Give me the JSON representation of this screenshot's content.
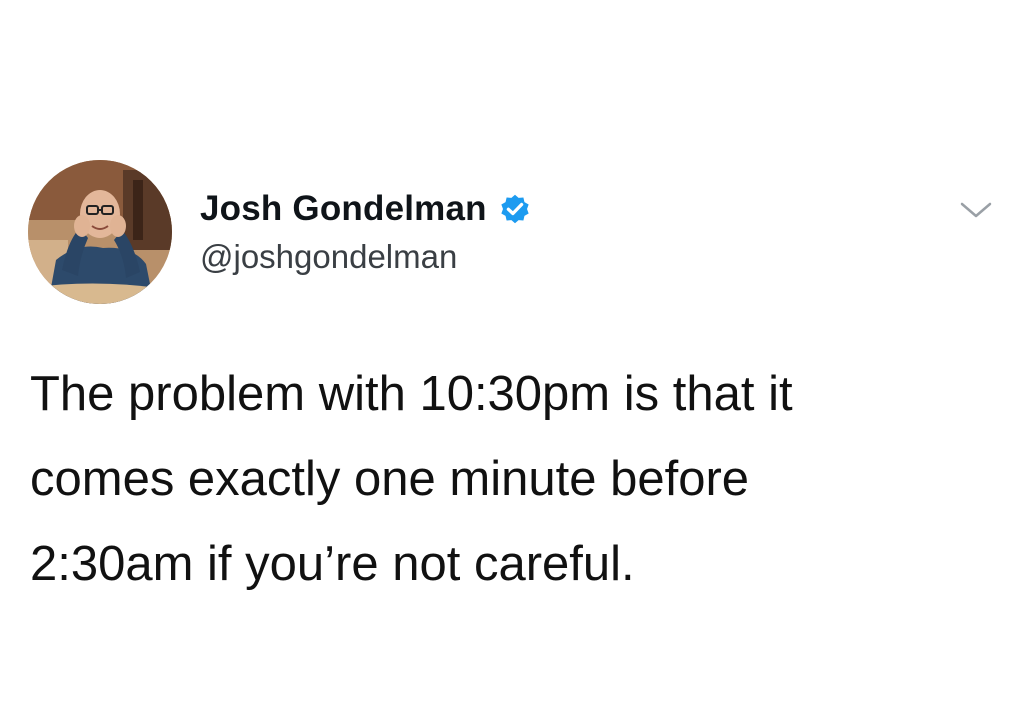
{
  "tweet": {
    "author": {
      "display_name": "Josh Gondelman",
      "handle": "@joshgondelman",
      "verified": true,
      "verified_icon": "verified-badge-icon",
      "verified_color": "#1d9bf0"
    },
    "menu_icon": "chevron-down-icon",
    "text_lines": [
      "The problem with 10:30pm is that it",
      "comes exactly one minute before",
      "2:30am if you’re not careful."
    ]
  },
  "colors": {
    "background": "#ffffff",
    "text": "#111111",
    "handle": "#3a3f44",
    "caret": "#9aa0a6"
  }
}
